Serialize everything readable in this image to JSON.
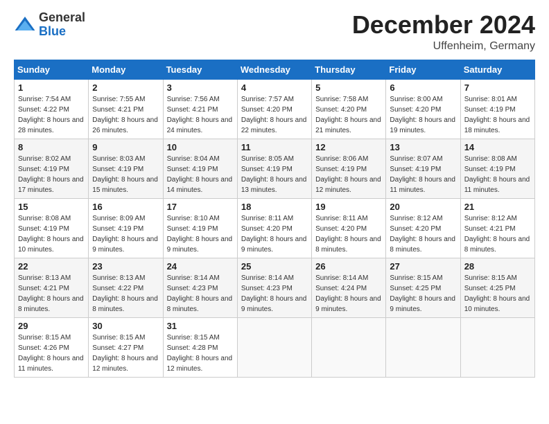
{
  "logo": {
    "general": "General",
    "blue": "Blue"
  },
  "title": {
    "month": "December 2024",
    "location": "Uffenheim, Germany"
  },
  "header": {
    "days": [
      "Sunday",
      "Monday",
      "Tuesday",
      "Wednesday",
      "Thursday",
      "Friday",
      "Saturday"
    ]
  },
  "weeks": [
    [
      {
        "day": "1",
        "sunrise": "7:54 AM",
        "sunset": "4:22 PM",
        "daylight": "8 hours and 28 minutes."
      },
      {
        "day": "2",
        "sunrise": "7:55 AM",
        "sunset": "4:21 PM",
        "daylight": "8 hours and 26 minutes."
      },
      {
        "day": "3",
        "sunrise": "7:56 AM",
        "sunset": "4:21 PM",
        "daylight": "8 hours and 24 minutes."
      },
      {
        "day": "4",
        "sunrise": "7:57 AM",
        "sunset": "4:20 PM",
        "daylight": "8 hours and 22 minutes."
      },
      {
        "day": "5",
        "sunrise": "7:58 AM",
        "sunset": "4:20 PM",
        "daylight": "8 hours and 21 minutes."
      },
      {
        "day": "6",
        "sunrise": "8:00 AM",
        "sunset": "4:20 PM",
        "daylight": "8 hours and 19 minutes."
      },
      {
        "day": "7",
        "sunrise": "8:01 AM",
        "sunset": "4:19 PM",
        "daylight": "8 hours and 18 minutes."
      }
    ],
    [
      {
        "day": "8",
        "sunrise": "8:02 AM",
        "sunset": "4:19 PM",
        "daylight": "8 hours and 17 minutes."
      },
      {
        "day": "9",
        "sunrise": "8:03 AM",
        "sunset": "4:19 PM",
        "daylight": "8 hours and 15 minutes."
      },
      {
        "day": "10",
        "sunrise": "8:04 AM",
        "sunset": "4:19 PM",
        "daylight": "8 hours and 14 minutes."
      },
      {
        "day": "11",
        "sunrise": "8:05 AM",
        "sunset": "4:19 PM",
        "daylight": "8 hours and 13 minutes."
      },
      {
        "day": "12",
        "sunrise": "8:06 AM",
        "sunset": "4:19 PM",
        "daylight": "8 hours and 12 minutes."
      },
      {
        "day": "13",
        "sunrise": "8:07 AM",
        "sunset": "4:19 PM",
        "daylight": "8 hours and 11 minutes."
      },
      {
        "day": "14",
        "sunrise": "8:08 AM",
        "sunset": "4:19 PM",
        "daylight": "8 hours and 11 minutes."
      }
    ],
    [
      {
        "day": "15",
        "sunrise": "8:08 AM",
        "sunset": "4:19 PM",
        "daylight": "8 hours and 10 minutes."
      },
      {
        "day": "16",
        "sunrise": "8:09 AM",
        "sunset": "4:19 PM",
        "daylight": "8 hours and 9 minutes."
      },
      {
        "day": "17",
        "sunrise": "8:10 AM",
        "sunset": "4:19 PM",
        "daylight": "8 hours and 9 minutes."
      },
      {
        "day": "18",
        "sunrise": "8:11 AM",
        "sunset": "4:20 PM",
        "daylight": "8 hours and 9 minutes."
      },
      {
        "day": "19",
        "sunrise": "8:11 AM",
        "sunset": "4:20 PM",
        "daylight": "8 hours and 8 minutes."
      },
      {
        "day": "20",
        "sunrise": "8:12 AM",
        "sunset": "4:20 PM",
        "daylight": "8 hours and 8 minutes."
      },
      {
        "day": "21",
        "sunrise": "8:12 AM",
        "sunset": "4:21 PM",
        "daylight": "8 hours and 8 minutes."
      }
    ],
    [
      {
        "day": "22",
        "sunrise": "8:13 AM",
        "sunset": "4:21 PM",
        "daylight": "8 hours and 8 minutes."
      },
      {
        "day": "23",
        "sunrise": "8:13 AM",
        "sunset": "4:22 PM",
        "daylight": "8 hours and 8 minutes."
      },
      {
        "day": "24",
        "sunrise": "8:14 AM",
        "sunset": "4:23 PM",
        "daylight": "8 hours and 8 minutes."
      },
      {
        "day": "25",
        "sunrise": "8:14 AM",
        "sunset": "4:23 PM",
        "daylight": "8 hours and 9 minutes."
      },
      {
        "day": "26",
        "sunrise": "8:14 AM",
        "sunset": "4:24 PM",
        "daylight": "8 hours and 9 minutes."
      },
      {
        "day": "27",
        "sunrise": "8:15 AM",
        "sunset": "4:25 PM",
        "daylight": "8 hours and 9 minutes."
      },
      {
        "day": "28",
        "sunrise": "8:15 AM",
        "sunset": "4:25 PM",
        "daylight": "8 hours and 10 minutes."
      }
    ],
    [
      {
        "day": "29",
        "sunrise": "8:15 AM",
        "sunset": "4:26 PM",
        "daylight": "8 hours and 11 minutes."
      },
      {
        "day": "30",
        "sunrise": "8:15 AM",
        "sunset": "4:27 PM",
        "daylight": "8 hours and 12 minutes."
      },
      {
        "day": "31",
        "sunrise": "8:15 AM",
        "sunset": "4:28 PM",
        "daylight": "8 hours and 12 minutes."
      },
      null,
      null,
      null,
      null
    ]
  ],
  "labels": {
    "sunrise": "Sunrise: ",
    "sunset": "Sunset: ",
    "daylight": "Daylight: "
  }
}
